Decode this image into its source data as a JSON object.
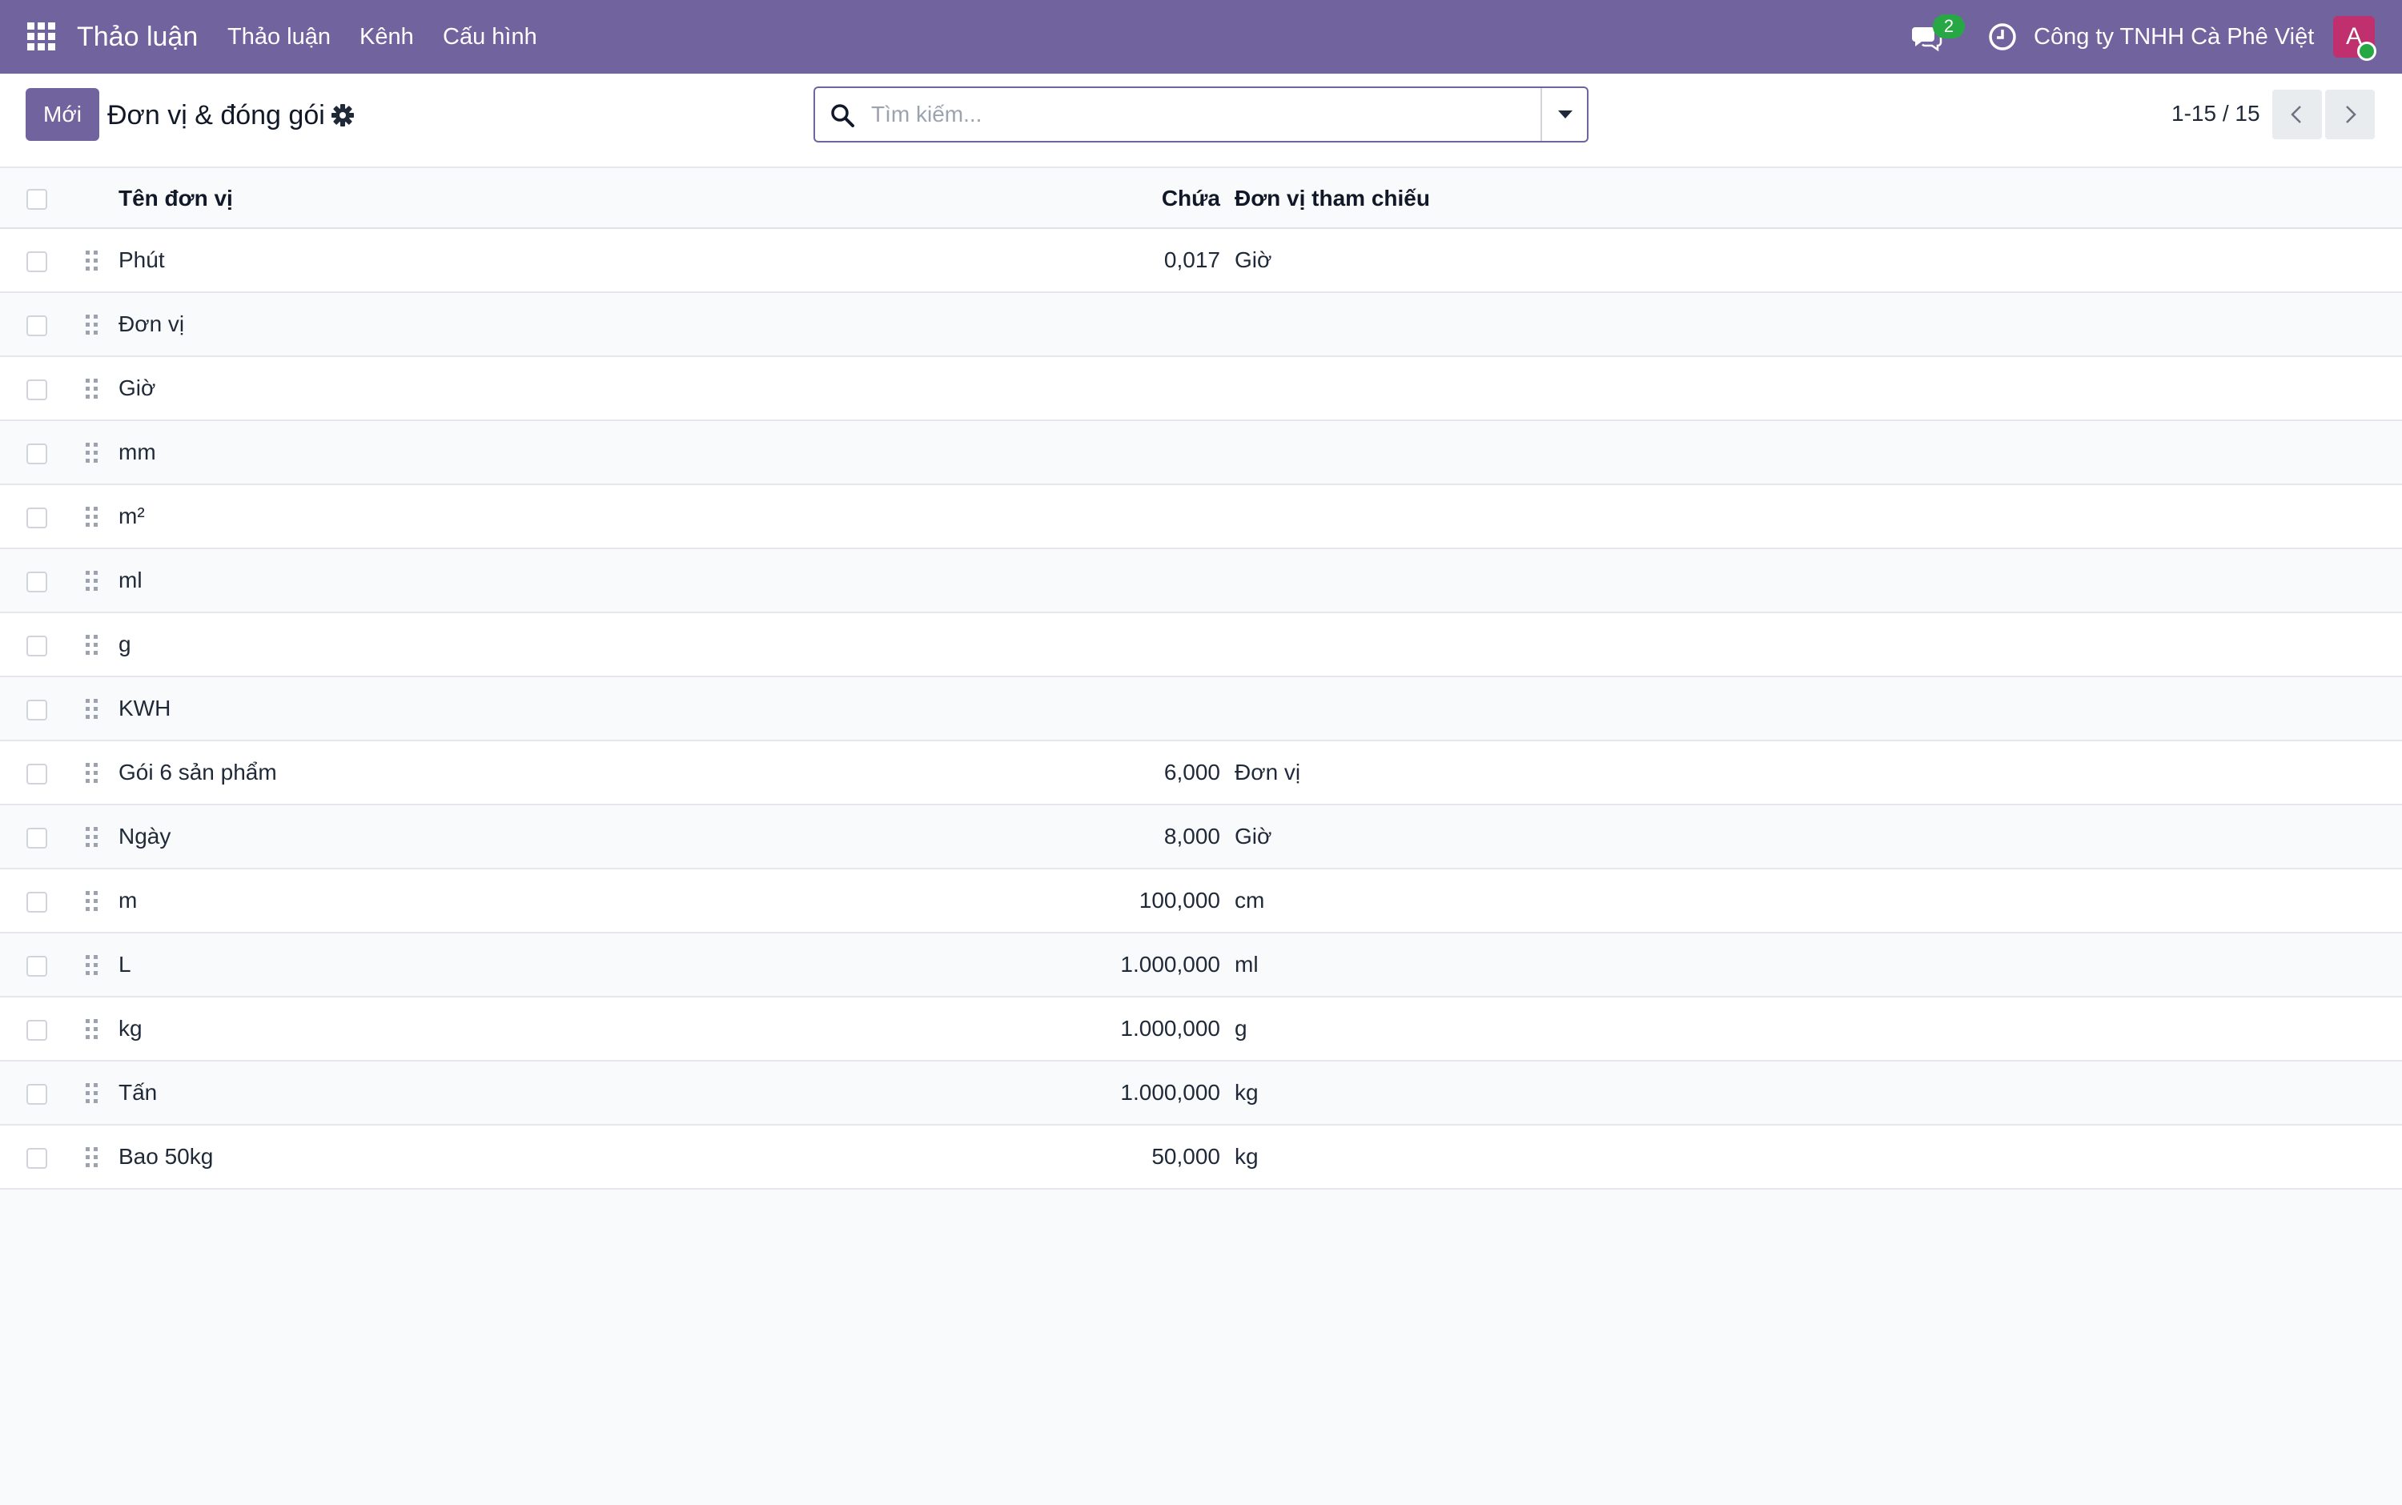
{
  "topbar": {
    "app_title": "Thảo luận",
    "menu": [
      "Thảo luận",
      "Kênh",
      "Cấu hình"
    ],
    "chat_badge": "2",
    "company": "Công ty TNHH Cà Phê Việt",
    "avatar_initial": "A",
    "colors": {
      "brand": "#71639e",
      "avatar": "#c0306f",
      "badge": "#28a745"
    }
  },
  "control": {
    "new_button": "Mới",
    "title": "Đơn vị & đóng gói",
    "search_placeholder": "Tìm kiếm...",
    "pager": "1-15 / 15"
  },
  "table": {
    "headers": {
      "name": "Tên đơn vị",
      "ratio": "Chứa",
      "reference": "Đơn vị tham chiếu"
    },
    "rows": [
      {
        "name": "Phút",
        "ratio": "0,017",
        "reference": "Giờ"
      },
      {
        "name": "Đơn vị",
        "ratio": "",
        "reference": ""
      },
      {
        "name": "Giờ",
        "ratio": "",
        "reference": ""
      },
      {
        "name": "mm",
        "ratio": "",
        "reference": ""
      },
      {
        "name": "m²",
        "ratio": "",
        "reference": ""
      },
      {
        "name": "ml",
        "ratio": "",
        "reference": ""
      },
      {
        "name": "g",
        "ratio": "",
        "reference": ""
      },
      {
        "name": "KWH",
        "ratio": "",
        "reference": ""
      },
      {
        "name": "Gói 6 sản phẩm",
        "ratio": "6,000",
        "reference": "Đơn vị"
      },
      {
        "name": "Ngày",
        "ratio": "8,000",
        "reference": "Giờ"
      },
      {
        "name": "m",
        "ratio": "100,000",
        "reference": "cm"
      },
      {
        "name": "L",
        "ratio": "1.000,000",
        "reference": "ml"
      },
      {
        "name": "kg",
        "ratio": "1.000,000",
        "reference": "g"
      },
      {
        "name": "Tấn",
        "ratio": "1.000,000",
        "reference": "kg"
      },
      {
        "name": "Bao 50kg",
        "ratio": "50,000",
        "reference": "kg"
      }
    ]
  }
}
